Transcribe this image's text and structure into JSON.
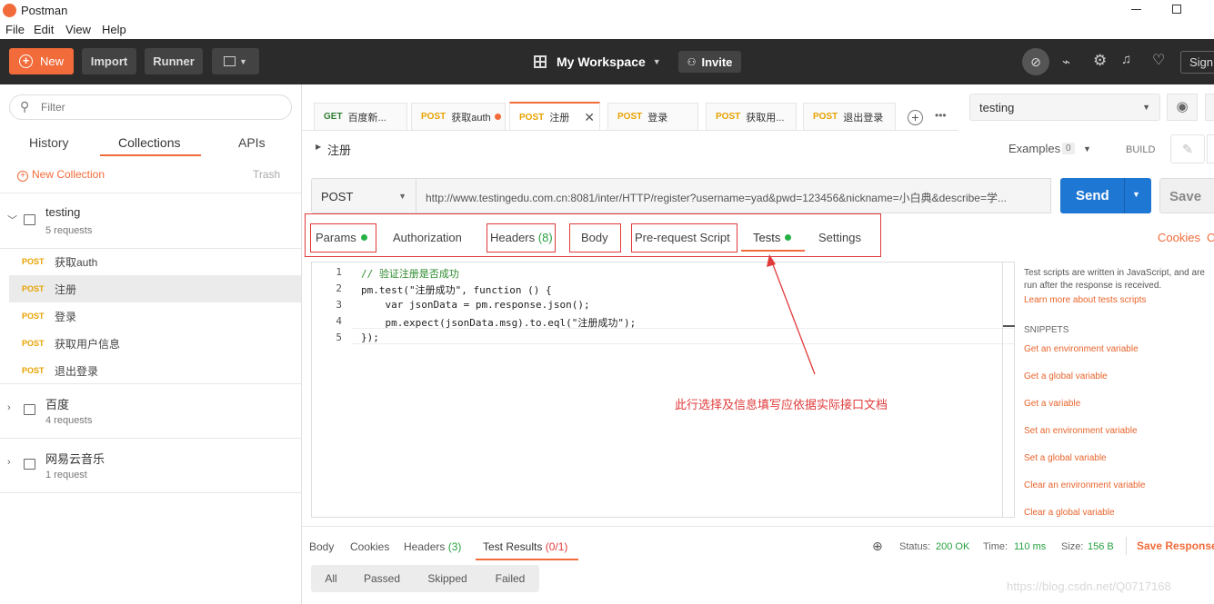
{
  "window": {
    "title": "Postman"
  },
  "menu": {
    "file": "File",
    "edit": "Edit",
    "view": "View",
    "help": "Help"
  },
  "toolbar": {
    "new": "New",
    "import": "Import",
    "runner": "Runner",
    "workspace": "My Workspace",
    "invite": "Invite",
    "sign": "Sign"
  },
  "sidebar": {
    "filter_placeholder": "Filter",
    "tabs": {
      "history": "History",
      "collections": "Collections",
      "apis": "APIs"
    },
    "new_collection": "New Collection",
    "trash": "Trash",
    "collections": [
      {
        "name": "testing",
        "count": "5 requests"
      },
      {
        "name": "百度",
        "count": "4 requests"
      },
      {
        "name": "网易云音乐",
        "count": "1 request"
      }
    ],
    "requests": [
      {
        "method": "POST",
        "name": "获取auth"
      },
      {
        "method": "POST",
        "name": "注册"
      },
      {
        "method": "POST",
        "name": "登录"
      },
      {
        "method": "POST",
        "name": "获取用户信息"
      },
      {
        "method": "POST",
        "name": "退出登录"
      }
    ]
  },
  "tabs": [
    {
      "method": "GET",
      "name": "百度新..."
    },
    {
      "method": "POST",
      "name": "获取auth"
    },
    {
      "method": "POST",
      "name": "注册"
    },
    {
      "method": "POST",
      "name": "登录"
    },
    {
      "method": "POST",
      "name": "获取用..."
    },
    {
      "method": "POST",
      "name": "退出登录"
    }
  ],
  "environment": {
    "selected": "testing"
  },
  "request": {
    "name": "注册",
    "examples": "Examples",
    "examples_count": "0",
    "build": "BUILD",
    "method": "POST",
    "url": "http://www.testingedu.com.cn:8081/inter/HTTP/register?username=yad&pwd=123456&nickname=小白典&describe=学...",
    "send": "Send",
    "save": "Save"
  },
  "subtabs": {
    "params": "Params",
    "authorization": "Authorization",
    "headers": "Headers",
    "headers_count": "(8)",
    "body": "Body",
    "prerequest": "Pre-request Script",
    "tests": "Tests",
    "settings": "Settings",
    "cookies": "Cookies",
    "code": "C"
  },
  "editor": {
    "line_numbers": [
      "1",
      "2",
      "3",
      "4",
      "5"
    ],
    "lines": [
      "// 验证注册是否成功",
      "pm.test(\"注册成功\", function () {",
      "    var jsonData = pm.response.json();",
      "    pm.expect(jsonData.msg).to.eql(\"注册成功\");",
      "});"
    ]
  },
  "annotation": "此行选择及信息填写应依据实际接口文档",
  "help": {
    "text": "Test scripts are written in JavaScript, and are run after the response is received.",
    "learn": "Learn more about tests scripts",
    "snippets_title": "SNIPPETS",
    "snippets": [
      "Get an environment variable",
      "Get a global variable",
      "Get a variable",
      "Set an environment variable",
      "Set a global variable",
      "Clear an environment variable",
      "Clear a global variable"
    ]
  },
  "response": {
    "tabs": {
      "body": "Body",
      "cookies": "Cookies",
      "headers": "Headers",
      "headers_count": "(3)",
      "test_results": "Test Results",
      "test_results_count": "(0/1)"
    },
    "status_label": "Status:",
    "status": "200 OK",
    "time_label": "Time:",
    "time": "110 ms",
    "size_label": "Size:",
    "size": "156 B",
    "save": "Save Response",
    "filters": {
      "all": "All",
      "passed": "Passed",
      "skipped": "Skipped",
      "failed": "Failed"
    }
  },
  "watermark": "https://blog.csdn.net/Q0717168",
  "colors": {
    "accent": "#f26b3a",
    "send": "#1e77d3",
    "toolbar": "#2b2b2b",
    "annotation": "#e03a3a"
  }
}
